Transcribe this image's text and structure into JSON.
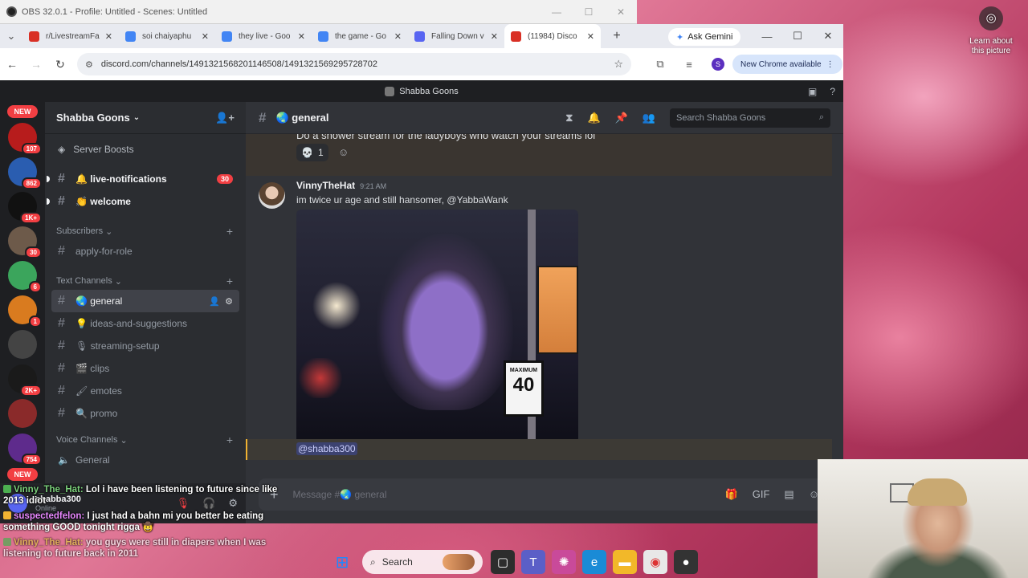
{
  "obs": {
    "title": "OBS 32.0.1 - Profile: Untitled - Scenes: Untitled"
  },
  "gemini_lens": {
    "label_line1": "Learn about",
    "label_line2": "this picture"
  },
  "browser": {
    "tabs": [
      {
        "label": "r/LivestreamFa",
        "icon_color": "#d93025",
        "icon": "reddit-icon"
      },
      {
        "label": "soi chaiyaphu",
        "icon_color": "#4285f4",
        "icon": "google-icon"
      },
      {
        "label": "they live - Goo",
        "icon_color": "#4285f4",
        "icon": "google-icon"
      },
      {
        "label": "the game - Go",
        "icon_color": "#4285f4",
        "icon": "google-icon"
      },
      {
        "label": "Falling Down v",
        "icon_color": "#5865f2",
        "icon": "video-icon"
      },
      {
        "label": "(11984) Disco",
        "icon_color": "#d93025",
        "icon": "discord-icon"
      }
    ],
    "ask_gemini": "Ask Gemini",
    "url": "discord.com/channels/1491321568201146508/1491321569295728702",
    "profile_initial": "S",
    "update_label": "New Chrome available"
  },
  "discord": {
    "window_title": "Shabba Goons",
    "server_name": "Shabba Goons",
    "server_boosts": "Server Boosts",
    "guild_badges": [
      "107",
      "862",
      "1K+",
      "30",
      "6",
      "1",
      "",
      "2K+",
      "",
      "754"
    ],
    "new_label": "NEW",
    "channels_top": [
      {
        "name": "🔔 live-notifications",
        "count": "30"
      },
      {
        "name": "👏 welcome",
        "count": ""
      }
    ],
    "cat_subscribers": "Subscribers",
    "channel_apply": "apply-for-role",
    "cat_text": "Text Channels",
    "text_channels": [
      "🌏 general",
      "💡 ideas-and-suggestions",
      "🎙 streaming-setup",
      "🎬 clips",
      "🖌 emotes",
      "🔍 promo"
    ],
    "cat_voice": "Voice Channels",
    "voice_general": "General",
    "user": {
      "name": "shabba300",
      "status": "Online"
    },
    "chat_channel": "🌏 general",
    "search_placeholder": "Search Shabba Goons",
    "prev_text": "Do a shower stream for the ladyboys who watch your streams lol",
    "reaction": {
      "emoji": "💀",
      "count": "1"
    },
    "message": {
      "author": "VinnyTheHat",
      "time": "9:21 AM",
      "text": "im twice ur age and still hansomer, @YabbaWank",
      "sign_top": "MAXIMUM",
      "sign_num": "40"
    },
    "mention": "@shabba300",
    "composer_placeholder": "Message #🌏 general"
  },
  "stream_chat": [
    {
      "user": "Vinny_The_Hat:",
      "text": " Lol i have been listening to future since like 2013 idiot"
    },
    {
      "user": "suspectedfelon:",
      "text": " I just had a bahn mi you better be eating something GOOD tonight rigga 🤠"
    },
    {
      "user": "Vinny_The_Hat:",
      "text": " you guys were still in diapers when I was listening to future back in 2011"
    }
  ],
  "taskbar": {
    "search_label": "Search"
  }
}
